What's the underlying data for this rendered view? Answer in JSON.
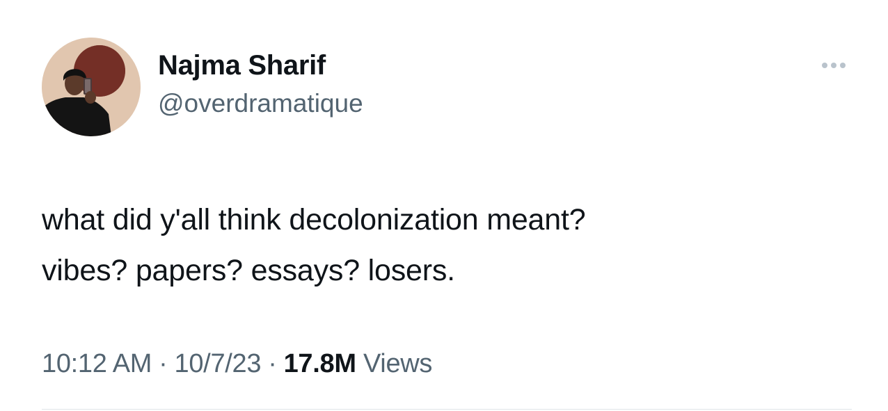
{
  "author": {
    "display_name": "Najma Sharif",
    "handle": "@overdramatique",
    "avatar_icon": "profile-photo"
  },
  "tweet": {
    "text": "what did y'all think decolonization meant?\nvibes? papers? essays? losers."
  },
  "meta": {
    "time": "10:12 AM",
    "separator": "·",
    "date": "10/7/23",
    "views_count": "17.8M",
    "views_label": "Views"
  },
  "menu": {
    "icon": "more-horizontal-icon"
  },
  "colors": {
    "primary_text": "#0f1419",
    "secondary_text": "#536471",
    "divider": "#dfe4e8",
    "menu_dots": "#b9c3cc"
  }
}
